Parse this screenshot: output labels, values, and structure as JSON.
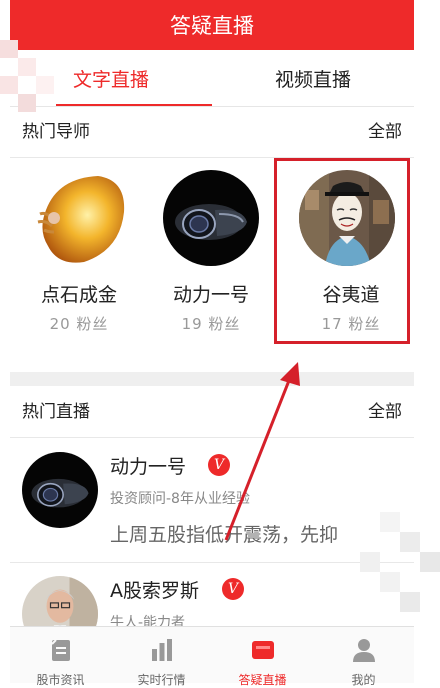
{
  "header": {
    "title": "答疑直播"
  },
  "tabs": [
    {
      "label": "文字直播",
      "active": true
    },
    {
      "label": "视频直播",
      "active": false
    }
  ],
  "hot_tutors": {
    "title": "热门导师",
    "all_label": "全部",
    "items": [
      {
        "name": "点石成金",
        "fans": "20 粉丝",
        "avatar_icon": "amber-stone-avatar"
      },
      {
        "name": "动力一号",
        "fans": "19 粉丝",
        "avatar_icon": "turbine-avatar"
      },
      {
        "name": "谷夷道",
        "fans": "17 粉丝",
        "avatar_icon": "masked-man-avatar"
      }
    ]
  },
  "hot_live": {
    "title": "热门直播",
    "all_label": "全部",
    "items": [
      {
        "name": "动力一号",
        "badge": "V",
        "subtitle": "投资顾问-8年从业经验",
        "text": "上周五股指低开震荡，先抑"
      },
      {
        "name": "A股索罗斯",
        "badge": "V",
        "subtitle": "牛人-能力者",
        "text": ""
      }
    ]
  },
  "bottom_nav": [
    {
      "label": "股市资讯",
      "icon": "document-icon",
      "active": false
    },
    {
      "label": "实时行情",
      "icon": "bar-chart-icon",
      "active": false
    },
    {
      "label": "答疑直播",
      "icon": "live-icon",
      "active": true
    },
    {
      "label": "我的",
      "icon": "user-icon",
      "active": false
    }
  ],
  "colors": {
    "accent": "#ee2a2a",
    "highlight_box": "#d5202a"
  }
}
